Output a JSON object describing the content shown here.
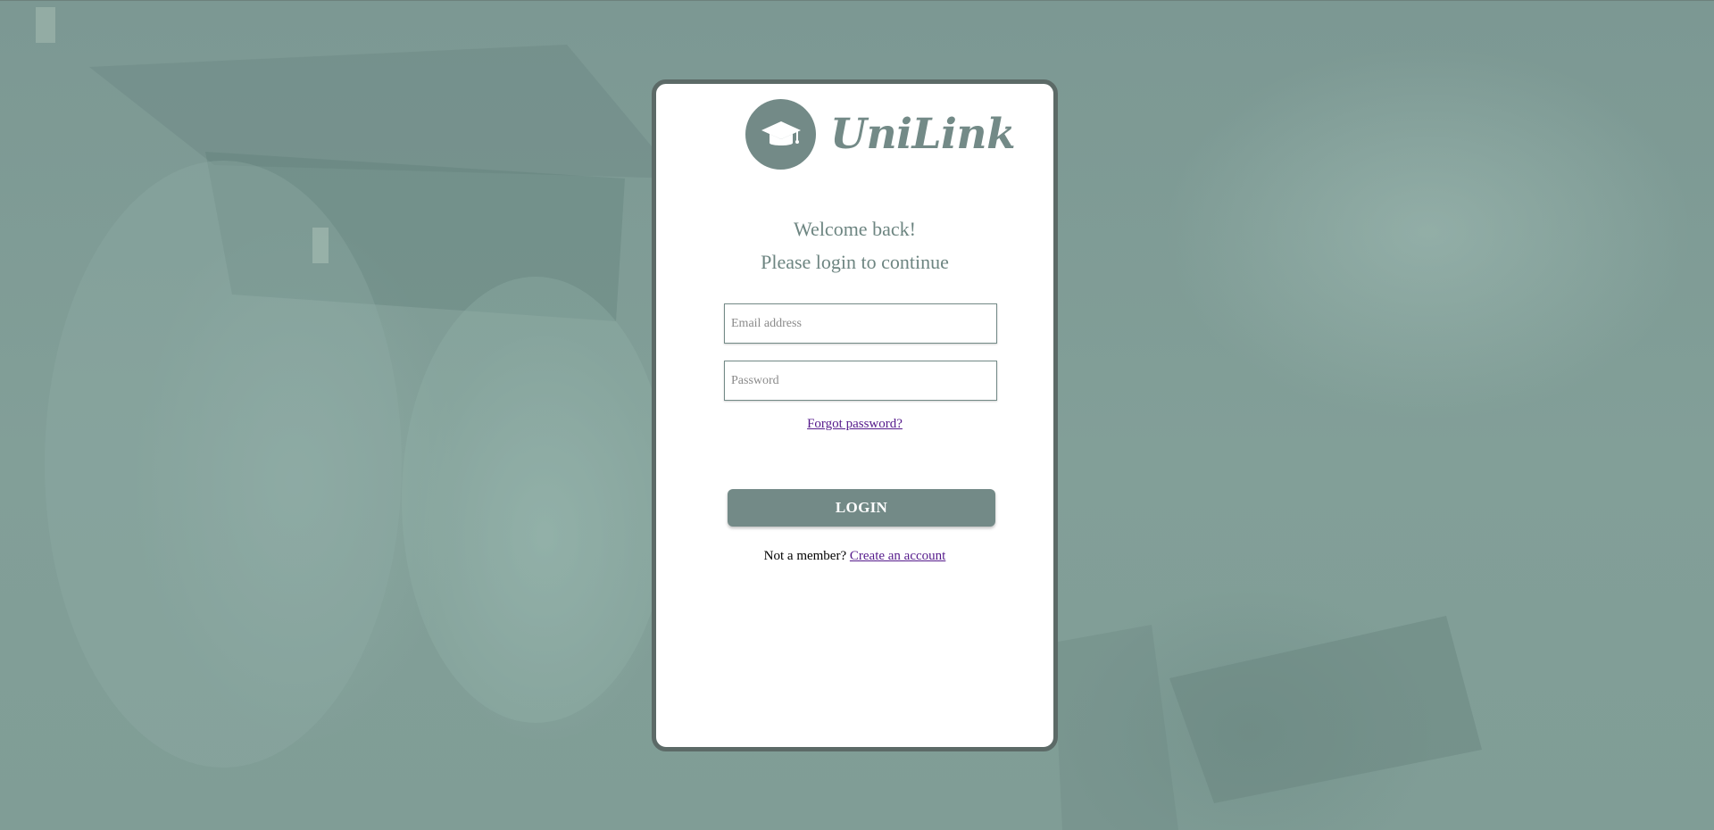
{
  "brand": {
    "name": "UniLink",
    "logo_icon": "graduation-cap-icon",
    "color": "#738a87"
  },
  "welcome": {
    "line1": "Welcome back!",
    "line2": "Please login to continue"
  },
  "form": {
    "email_placeholder": "Email address",
    "email_value": "",
    "password_placeholder": "Password",
    "password_value": "",
    "forgot_label": "Forgot password?",
    "login_label": "LOGIN"
  },
  "signup": {
    "prompt": "Not a member?",
    "link_label": "Create an account"
  },
  "colors": {
    "background_tint": "#7f9f98",
    "card_border": "#5c6a67",
    "link": "#551a8b"
  }
}
